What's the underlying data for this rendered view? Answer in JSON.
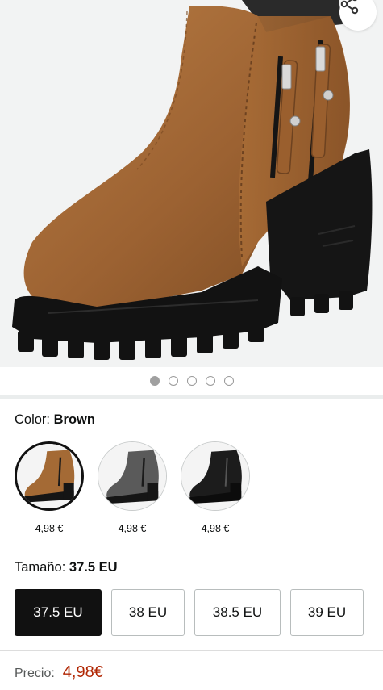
{
  "gallery": {
    "image_alt": "Botín marrón con cremalleras y tacón ancho",
    "page_count": 5,
    "active_page": 1,
    "share_icon": "share-icon"
  },
  "color": {
    "label": "Color:",
    "selected": "Brown",
    "options": [
      {
        "name": "Brown",
        "price": "4,98 €",
        "color": "#a46a35",
        "selected": true
      },
      {
        "name": "Grey",
        "price": "4,98 €",
        "color": "#5a5a5a",
        "selected": false
      },
      {
        "name": "Black",
        "price": "4,98 €",
        "color": "#1c1c1c",
        "selected": false
      }
    ]
  },
  "size": {
    "label": "Tamaño:",
    "selected": "37.5 EU",
    "options": [
      "37.5 EU",
      "38 EU",
      "38.5 EU",
      "39 EU"
    ]
  },
  "price": {
    "label": "Precio:",
    "value": "4,98€"
  },
  "colors": {
    "price_red": "#b12704",
    "selected_dark": "#111111",
    "boot_brown": "#a46a35",
    "sole_black": "#121212"
  }
}
